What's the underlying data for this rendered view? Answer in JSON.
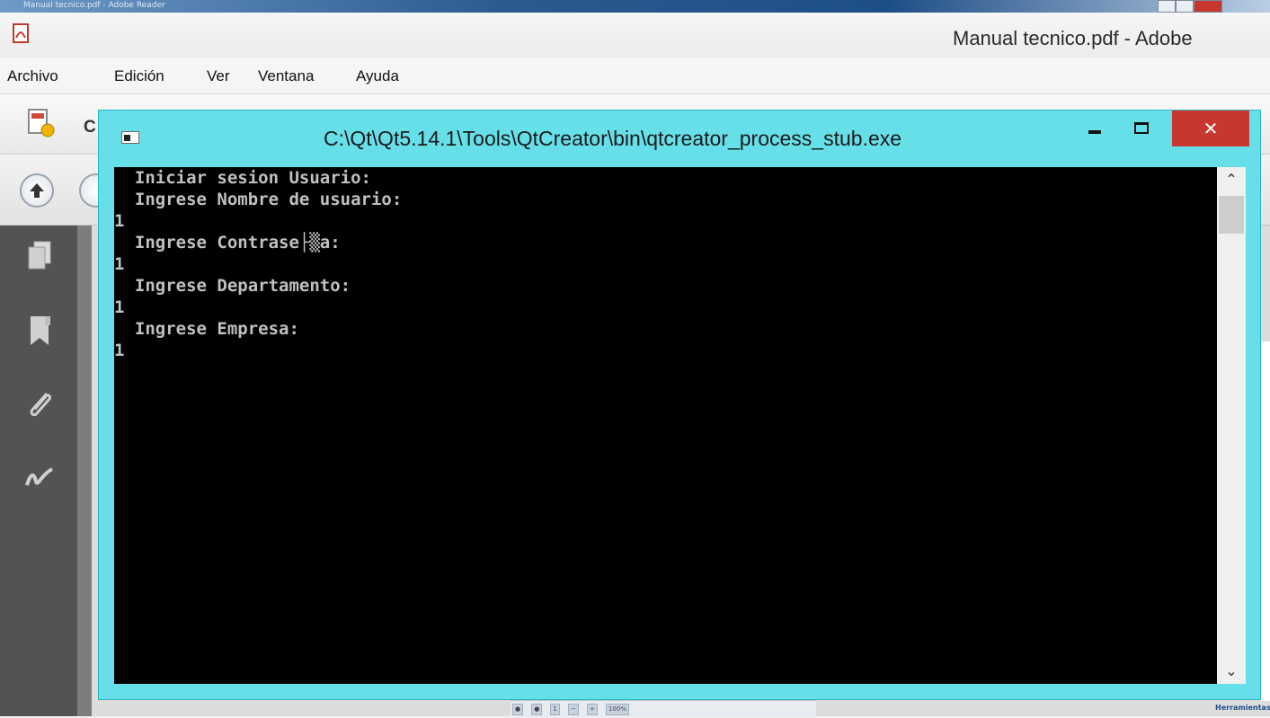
{
  "background_window": {
    "title": "Manual tecnico.pdf - Adobe",
    "menu": [
      "Archivo",
      "Edición",
      "Ver",
      "Ventana",
      "Ayuda"
    ],
    "toolbar_partial_label": "C",
    "sidebar_icons": [
      "pages-icon",
      "bookmark-icon",
      "attachment-icon",
      "signature-icon"
    ],
    "status_zoom": "100%"
  },
  "console": {
    "title": "C:\\Qt\\Qt5.14.1\\Tools\\QtCreator\\bin\\qtcreator_process_stub.exe",
    "close_label": "✕",
    "lines": [
      "  Iniciar sesion Usuario:",
      "  Ingrese Nombre de usuario:",
      "1",
      "  Ingrese Contrase├▒a:",
      "1",
      "  Ingrese Departamento:",
      "1",
      "  Ingrese Empresa:",
      "1"
    ]
  },
  "colors": {
    "console_border": "#67dfe9",
    "close_button": "#c7372f",
    "console_text": "#c0c0c0"
  }
}
